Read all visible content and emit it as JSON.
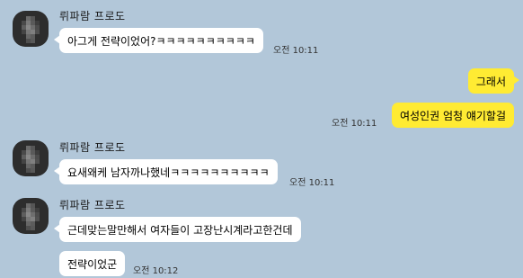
{
  "sender_name": "뤼파람 프로도",
  "messages": [
    {
      "text": "아그게 전략이었어?ㅋㅋㅋㅋㅋㅋㅋㅋㅋㅋ",
      "time": "오전 10:11"
    },
    {
      "text": "그래서"
    },
    {
      "text": "여성인권 엄청 얘기할걸",
      "time": "오전 10:11"
    },
    {
      "text": "요새왜케 남자까나했네ㅋㅋㅋㅋㅋㅋㅋㅋㅋㅋ",
      "time": "오전 10:11"
    },
    {
      "text": "근데맞는말만해서 여자들이 고장난시계라고한건데"
    },
    {
      "text": "전략이었군",
      "time": "오전 10:12"
    }
  ],
  "colors": {
    "background": "#b2c7d9",
    "incoming_bubble": "#ffffff",
    "outgoing_bubble": "#ffeb33"
  }
}
